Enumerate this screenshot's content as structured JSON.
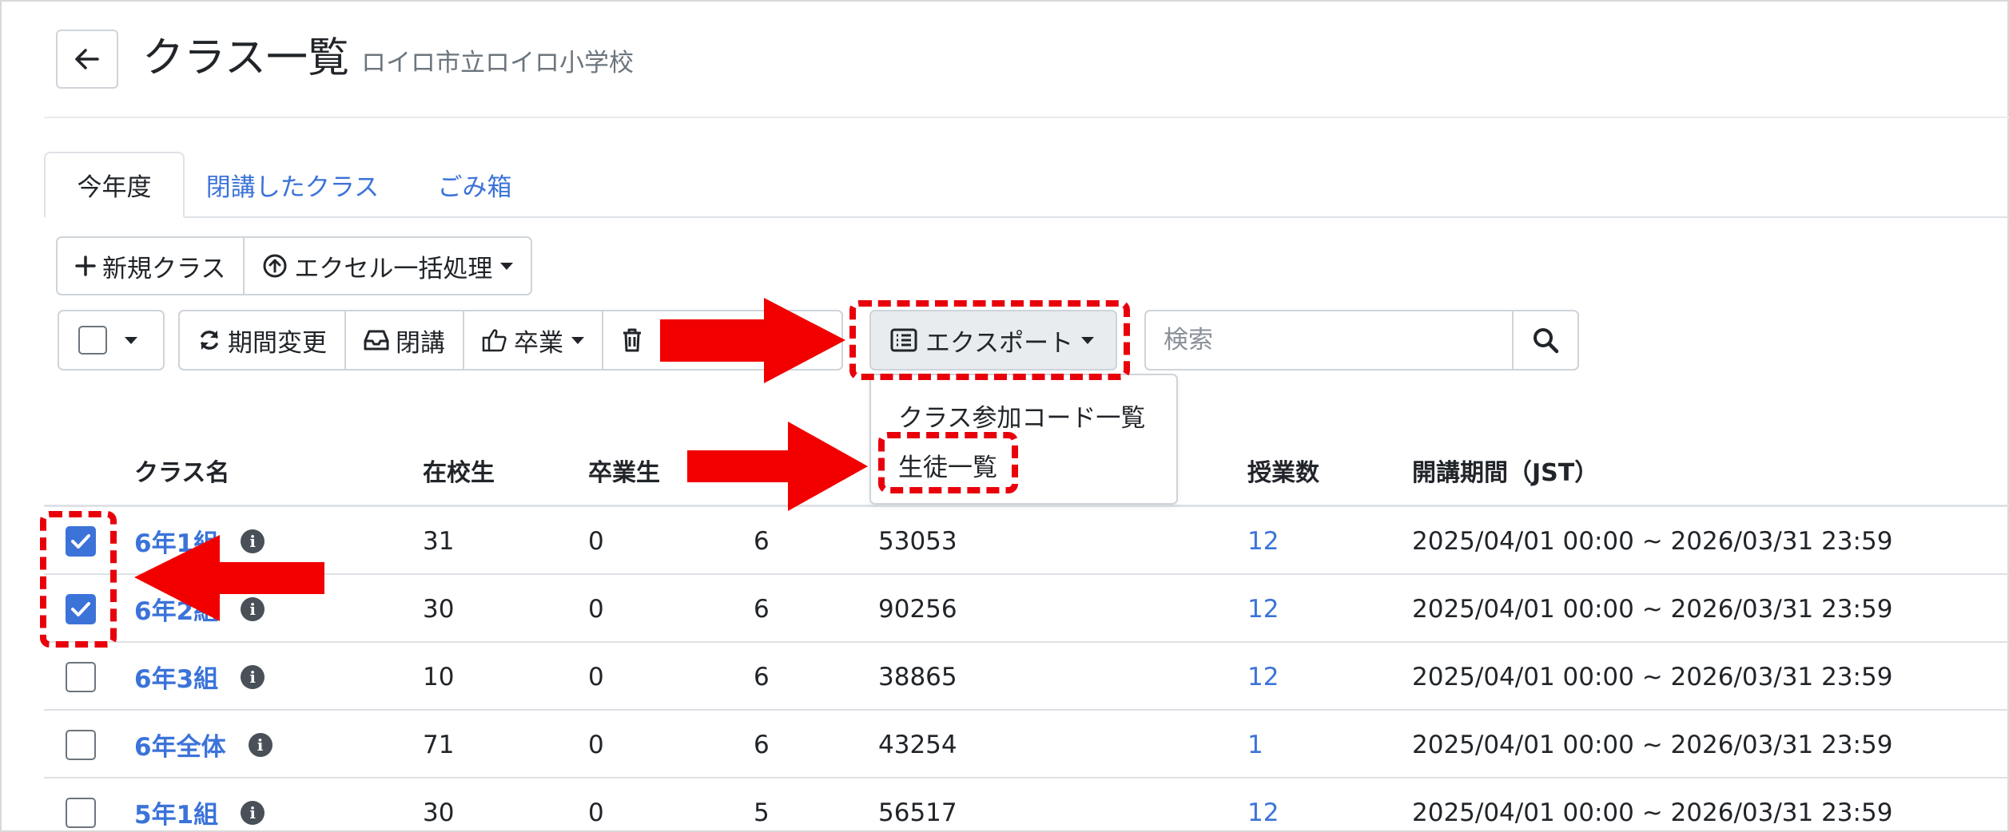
{
  "header": {
    "title": "クラス一覧",
    "subtitle": "ロイロ市立ロイロ小学校"
  },
  "tabs": [
    {
      "label": "今年度",
      "active": true
    },
    {
      "label": "閉講したクラス",
      "active": false
    },
    {
      "label": "ごみ箱",
      "active": false
    }
  ],
  "toolbar_top": {
    "new_class": "新規クラス",
    "excel_bulk": "エクセル一括処理"
  },
  "toolbar_actions": {
    "change_period": "期間変更",
    "close": "閉講",
    "graduate": "卒業"
  },
  "export": {
    "label": "エクスポート",
    "menu": [
      "クラス参加コード一覧",
      "生徒一覧"
    ]
  },
  "search": {
    "placeholder": "検索"
  },
  "table": {
    "headers": {
      "name": "クラス名",
      "enrolled": "在校生",
      "graduated": "卒業生",
      "lessons": "授業数",
      "period": "開講期間（JST）"
    },
    "rows": [
      {
        "name": "6年1組",
        "enrolled": "31",
        "graduated": "0",
        "grade": "6",
        "code": "53053",
        "lessons": "12",
        "period": "2025/04/01 00:00 ~ 2026/03/31 23:59",
        "checked": true
      },
      {
        "name": "6年2組",
        "enrolled": "30",
        "graduated": "0",
        "grade": "6",
        "code": "90256",
        "lessons": "12",
        "period": "2025/04/01 00:00 ~ 2026/03/31 23:59",
        "checked": true
      },
      {
        "name": "6年3組",
        "enrolled": "10",
        "graduated": "0",
        "grade": "6",
        "code": "38865",
        "lessons": "12",
        "period": "2025/04/01 00:00 ~ 2026/03/31 23:59",
        "checked": false
      },
      {
        "name": "6年全体",
        "enrolled": "71",
        "graduated": "0",
        "grade": "6",
        "code": "43254",
        "lessons": "1",
        "period": "2025/04/01 00:00 ~ 2026/03/31 23:59",
        "checked": false
      },
      {
        "name": "5年1組",
        "enrolled": "30",
        "graduated": "0",
        "grade": "5",
        "code": "56517",
        "lessons": "12",
        "period": "2025/04/01 00:00 ~ 2026/03/31 23:59",
        "checked": false
      }
    ]
  },
  "colors": {
    "link": "#3b73d9",
    "annotation": "#e8000b",
    "border": "#ced4da"
  }
}
